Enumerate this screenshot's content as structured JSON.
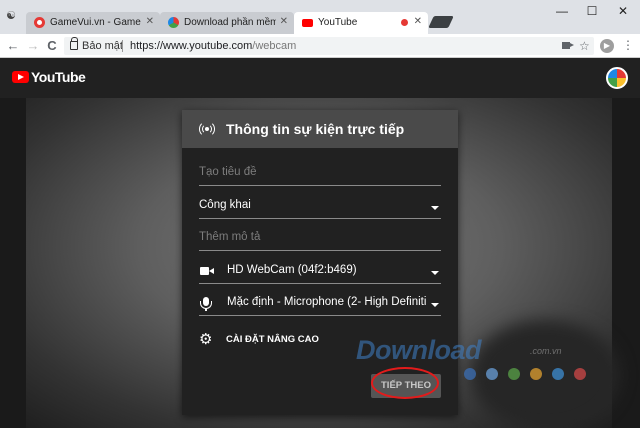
{
  "tabs": [
    {
      "title": "GameVui.vn - Game hay",
      "favicon": "gamevui-icon",
      "active": false
    },
    {
      "title": "Download phần mềm m",
      "favicon": "download-icon",
      "active": false
    },
    {
      "title": "YouTube",
      "favicon": "youtube-icon",
      "active": true,
      "recording": true
    }
  ],
  "window_controls": {
    "minimize": "—",
    "maximize": "☐",
    "close": "✕"
  },
  "toolbar": {
    "back": "←",
    "forward": "→",
    "reload": "C",
    "security_label": "Bảo mật",
    "url_host": "https://www.youtube.com",
    "url_path": "/webcam",
    "star": "☆",
    "menu": "⋮"
  },
  "youtube": {
    "logo_text": "YouTube",
    "accent": "#ff0000"
  },
  "dialog": {
    "title": "Thông tin sự kiện trực tiếp",
    "title_placeholder": "Tạo tiêu đề",
    "privacy_value": "Công khai",
    "description_placeholder": "Thêm mô tả",
    "camera_value": "HD WebCam (04f2:b469)",
    "mic_value": "Mặc định - Microphone (2- High Definiti",
    "advanced_label": "CÀI ĐẶT NÂNG CAO",
    "next_label": "TIẾP THEO"
  },
  "watermark": {
    "text": "Download",
    "suffix": ".com.vn",
    "dot_colors": [
      "#3b6fb6",
      "#6a9fd8",
      "#5aa248",
      "#e0a030",
      "#3d8dd1",
      "#d04848"
    ]
  }
}
